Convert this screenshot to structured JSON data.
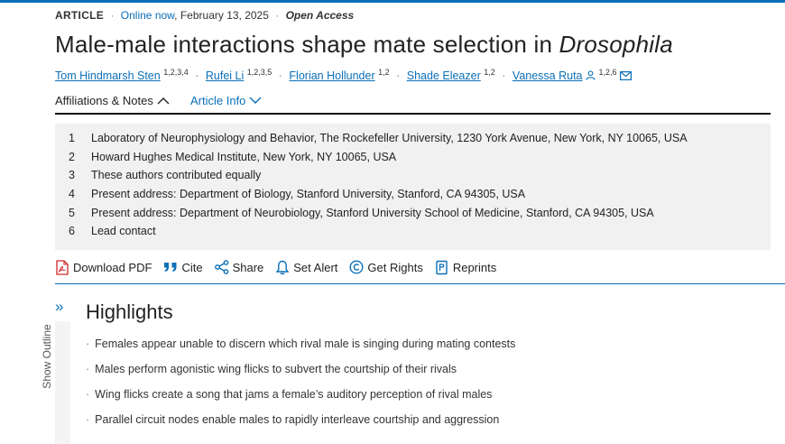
{
  "header": {
    "article_type": "ARTICLE",
    "online_date": "Online now",
    "date": "February 13, 2025",
    "access": "Open Access",
    "title_main": "Male-male interactions shape mate selection in ",
    "title_genus": "Drosophila"
  },
  "authors": [
    {
      "name": "Tom Hindmarsh Sten",
      "affil": "1,2,3,4"
    },
    {
      "name": "Rufei Li",
      "affil": "1,2,3,5"
    },
    {
      "name": "Florian Hollunder",
      "affil": "1,2"
    },
    {
      "name": "Shade Eleazer",
      "affil": "1,2"
    },
    {
      "name": "Vanessa Ruta",
      "affil": "1,2,6"
    }
  ],
  "tabs": {
    "affiliations": "Affiliations & Notes",
    "article_info": "Article Info"
  },
  "affiliations": [
    {
      "num": "1",
      "text": "Laboratory of Neurophysiology and Behavior, The Rockefeller University, 1230 York Avenue, New York, NY 10065, USA"
    },
    {
      "num": "2",
      "text": "Howard Hughes Medical Institute, New York, NY 10065, USA"
    },
    {
      "num": "3",
      "text": "These authors contributed equally"
    },
    {
      "num": "4",
      "text": "Present address: Department of Biology, Stanford University, Stanford, CA 94305, USA"
    },
    {
      "num": "5",
      "text": "Present address: Department of Neurobiology, Stanford University School of Medicine, Stanford, CA 94305, USA"
    },
    {
      "num": "6",
      "text": "Lead contact"
    }
  ],
  "tools": {
    "download_pdf": "Download PDF",
    "cite": "Cite",
    "share": "Share",
    "set_alert": "Set Alert",
    "get_rights": "Get Rights",
    "reprints": "Reprints"
  },
  "outline": {
    "label": "Show Outline",
    "toggle": "»"
  },
  "highlights": {
    "heading": "Highlights",
    "items": [
      "Females appear unable to discern which rival male is singing during mating contests",
      "Males perform agonistic wing flicks to subvert the courtship of their rivals",
      "Wing flicks create a song that jams a female’s auditory perception of rival males",
      "Parallel circuit nodes enable males to rapidly interleave courtship and aggression"
    ]
  },
  "colors": {
    "accent": "#0b6fb8",
    "pdf_red": "#d0262b",
    "panel_bg": "#f1f1f1"
  },
  "icons": {
    "pdf": "pdf-icon",
    "cite": "quote-icon",
    "share": "share-icon",
    "alert": "bell-icon",
    "rights": "copyright-icon",
    "reprints": "reprints-icon",
    "person": "person-icon",
    "mail": "mail-icon",
    "chevron_up": "chevron-up-icon",
    "chevron_down": "chevron-down-icon"
  }
}
